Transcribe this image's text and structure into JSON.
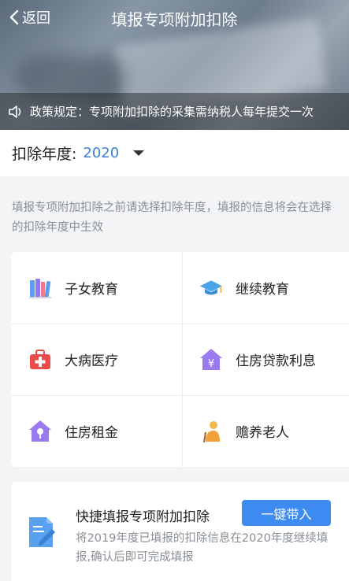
{
  "header": {
    "back_label": "返回",
    "title": "填报专项附加扣除",
    "notice": "政策规定：专项附加扣除的采集需纳税人每年提交一次"
  },
  "year_selector": {
    "label": "扣除年度:",
    "value": "2020"
  },
  "hint": "填报专项附加扣除之前请选择扣除年度，填报的信息将会在选择的扣除年度中生效",
  "categories": [
    {
      "label": "子女教育",
      "icon": "books-icon"
    },
    {
      "label": "继续教育",
      "icon": "graduation-cap-icon"
    },
    {
      "label": "大病医疗",
      "icon": "medical-kit-icon"
    },
    {
      "label": "住房贷款利息",
      "icon": "house-yen-icon"
    },
    {
      "label": "住房租金",
      "icon": "house-key-icon"
    },
    {
      "label": "赡养老人",
      "icon": "elderly-person-icon"
    }
  ],
  "quick_fill": {
    "title": "快捷填报专项附加扣除",
    "button_label": "一键带入",
    "description": "将2019年度已填报的扣除信息在2020年度继续填报,确认后即可完成填报"
  }
}
